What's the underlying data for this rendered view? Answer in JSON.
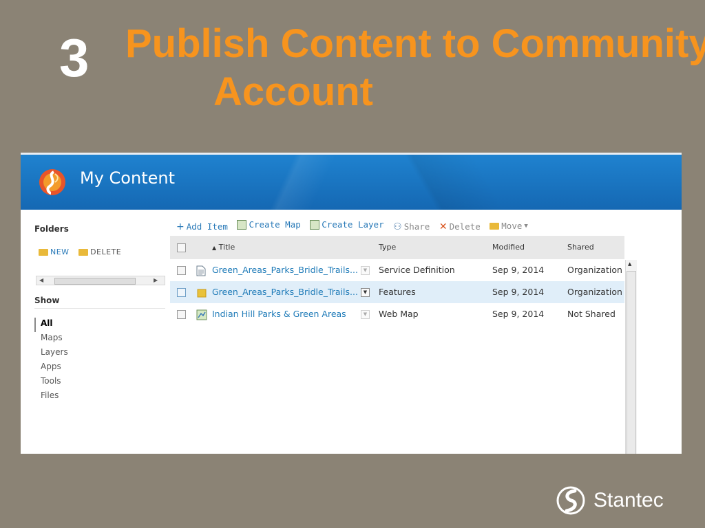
{
  "slide": {
    "step_number": "3",
    "title_line1": "Publish Content to Community",
    "title_line2": "Account"
  },
  "banner": {
    "title": "My Content"
  },
  "sidebar": {
    "folders_heading": "Folders",
    "new_label": "NEW",
    "delete_label": "DELETE",
    "show_heading": "Show",
    "show_items": [
      "All",
      "Maps",
      "Layers",
      "Apps",
      "Tools",
      "Files"
    ],
    "active_item": "All"
  },
  "toolbar": {
    "add_item": "Add Item",
    "create_map": "Create Map",
    "create_layer": "Create Layer",
    "share": "Share",
    "delete": "Delete",
    "move": "Move"
  },
  "table": {
    "columns": {
      "title": "Title",
      "type": "Type",
      "modified": "Modified",
      "shared": "Shared"
    },
    "sort_indicator": "▲",
    "rows": [
      {
        "title": "Green_Areas_Parks_Bridle_Trails...",
        "type": "Service Definition",
        "modified": "Sep 9, 2014",
        "shared": "Organization",
        "icon": "document-icon",
        "selected": false
      },
      {
        "title": "Green_Areas_Parks_Bridle_Trails...",
        "type": "Features",
        "modified": "Sep 9, 2014",
        "shared": "Organization",
        "icon": "feature-layer-icon",
        "selected": true
      },
      {
        "title": "Indian Hill Parks & Green Areas",
        "type": "Web Map",
        "modified": "Sep 9, 2014",
        "shared": "Not Shared",
        "icon": "web-map-icon",
        "selected": false
      }
    ]
  },
  "footer": {
    "brand": "Stantec"
  },
  "colors": {
    "background": "#8b8375",
    "title_orange": "#f7941e",
    "banner_blue": "#1b78c5",
    "link_blue": "#1f7bb8"
  }
}
